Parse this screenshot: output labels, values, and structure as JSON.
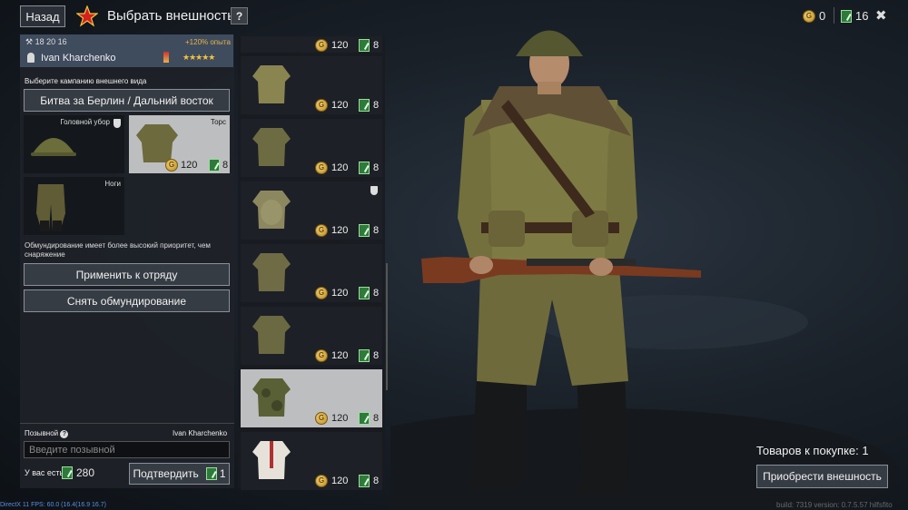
{
  "header": {
    "back_label": "Назад",
    "title": "Выбрать внешность",
    "help_label": "?",
    "gold": "0",
    "tickets": "16",
    "close_label": "✖"
  },
  "soldier": {
    "stats": "18  20  16",
    "exp_bonus": "+120% опыта",
    "name": "Ivan Kharchenko",
    "rank_stars": "★★★★★"
  },
  "campaign": {
    "label": "Выберите кампанию внешнего вида",
    "selected": "Битва за Берлин / Дальний восток"
  },
  "slots": [
    {
      "label": "Головной убор"
    },
    {
      "label": "Торс",
      "price": "120",
      "tickets": "8"
    },
    {
      "label": "Ноги"
    }
  ],
  "note": "Обмундирование имеет более высокий приоритет, чем снаряжение",
  "buttons": {
    "apply": "Применить к отряду",
    "remove": "Снять обмундирование",
    "confirm": "Подтвердить",
    "buy": "Приобрести внешность"
  },
  "callsign": {
    "label": "Позывной",
    "help": "?",
    "name": "Ivan Kharchenko",
    "placeholder": "Введите позывной",
    "have_label": "У вас есть",
    "have_tickets": "280",
    "confirm_tickets": "1"
  },
  "items": [
    {
      "price": "120",
      "tickets": "8"
    },
    {
      "price": "120",
      "tickets": "8"
    },
    {
      "price": "120",
      "tickets": "8"
    },
    {
      "price": "120",
      "tickets": "8"
    },
    {
      "price": "120",
      "tickets": "8"
    },
    {
      "price": "120",
      "tickets": "8"
    },
    {
      "price": "120",
      "tickets": "8"
    },
    {
      "price": "120",
      "tickets": "8"
    }
  ],
  "cart": {
    "to_buy": "Товаров к покупке: 1"
  },
  "debug": {
    "fps": "DirectX 11 FPS: 60.0 (16.4(16.9 16.7)",
    "version": "build: 7319 version: 0.7.5.57  hilfsfito"
  }
}
